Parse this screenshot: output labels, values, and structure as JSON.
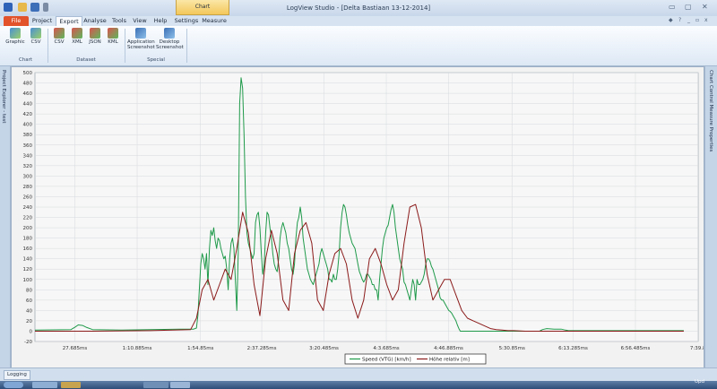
{
  "window": {
    "title": "LogView Studio - [Delta Bastiaan 13-12-2014]",
    "context_tab": "Chart",
    "controls": [
      "▭",
      "▢",
      "✕"
    ],
    "mini_controls": [
      "◆",
      "?",
      "_",
      "▫",
      "x"
    ]
  },
  "ribbon": {
    "tabs": [
      "File",
      "Project",
      "Export",
      "Analyse",
      "Tools",
      "View",
      "Help",
      "Settings",
      "Measure"
    ],
    "active_tab": "Export",
    "groups": [
      {
        "label": "Chart",
        "buttons": [
          {
            "l1": "Graphic",
            "l2": ""
          },
          {
            "l1": "CSV",
            "l2": ""
          }
        ]
      },
      {
        "label": "Dataset",
        "buttons": [
          {
            "l1": "CSV",
            "l2": ""
          },
          {
            "l1": "XML",
            "l2": ""
          },
          {
            "l1": "JSON",
            "l2": ""
          },
          {
            "l1": "KML",
            "l2": ""
          }
        ]
      },
      {
        "label": "Special",
        "buttons": [
          {
            "l1": "Application",
            "l2": "Screenshot"
          },
          {
            "l1": "Desktop",
            "l2": "Screenshot"
          }
        ]
      }
    ]
  },
  "sidepanels": {
    "left": "Project Explorer - test",
    "right": "Chart Control  Measure  Properties"
  },
  "bottom": {
    "logging_tab": "Logging",
    "status": "Upd"
  },
  "chart_data": {
    "type": "line",
    "yticks": [
      -20,
      0,
      20,
      40,
      60,
      80,
      100,
      120,
      140,
      160,
      180,
      200,
      220,
      240,
      260,
      280,
      300,
      320,
      340,
      360,
      380,
      400,
      420,
      440,
      460,
      480,
      500
    ],
    "xticks": [
      "27.685ms",
      "1:10.885ms",
      "1:54.85ms",
      "2:37.285ms",
      "3:20.485ms",
      "4:3.685ms",
      "4:46.885ms",
      "5:30.85ms",
      "6:13.285ms",
      "6:56.485ms",
      "7:39.8"
    ],
    "xtick_seconds": [
      27.685,
      70.885,
      114.85,
      157.285,
      200.485,
      243.685,
      286.885,
      330.85,
      373.285,
      416.485,
      459.8
    ],
    "x_range_seconds": [
      0,
      460
    ],
    "ylim": [
      -20,
      500
    ],
    "grid": true,
    "legend_position": "bottom-center",
    "series": [
      {
        "name": "Speed (VTG) [km/h]",
        "color": "#1f9a4a",
        "x": [
          0,
          25,
          28,
          30,
          33,
          36,
          40,
          60,
          80,
          100,
          110,
          112,
          113,
          114,
          115,
          116,
          117,
          118,
          119,
          120,
          121,
          122,
          123,
          124,
          125,
          126,
          127,
          128,
          129,
          130,
          131,
          132,
          133,
          134,
          135,
          136,
          137,
          138,
          139,
          140,
          141,
          142,
          143,
          144,
          145,
          146,
          147,
          148,
          149,
          150,
          151,
          152,
          153,
          154,
          155,
          156,
          157,
          158,
          159,
          160,
          161,
          162,
          163,
          164,
          165,
          166,
          167,
          168,
          169,
          170,
          171,
          172,
          173,
          174,
          175,
          176,
          177,
          178,
          179,
          180,
          181,
          182,
          183,
          184,
          185,
          186,
          187,
          188,
          189,
          190,
          191,
          192,
          193,
          194,
          195,
          196,
          197,
          198,
          199,
          200,
          201,
          202,
          203,
          204,
          205,
          206,
          207,
          208,
          209,
          210,
          211,
          212,
          213,
          214,
          215,
          216,
          217,
          218,
          219,
          220,
          221,
          222,
          223,
          224,
          225,
          226,
          227,
          228,
          229,
          230,
          231,
          232,
          233,
          234,
          235,
          236,
          237,
          238,
          239,
          240,
          241,
          242,
          243,
          244,
          245,
          246,
          247,
          248,
          249,
          250,
          251,
          252,
          253,
          254,
          255,
          256,
          257,
          258,
          259,
          260,
          261,
          262,
          263,
          264,
          265,
          266,
          267,
          268,
          269,
          270,
          271,
          272,
          273,
          274,
          275,
          276,
          277,
          278,
          279,
          280,
          281,
          282,
          283,
          284,
          285,
          286,
          287,
          288,
          289,
          290,
          291,
          292,
          293,
          294,
          295,
          296,
          297,
          298,
          299,
          300,
          301,
          302,
          303,
          304,
          305,
          306,
          307,
          308,
          309,
          310,
          311,
          312,
          313,
          314,
          315,
          316,
          317,
          318,
          319,
          320,
          321,
          322,
          323,
          324,
          325,
          326,
          327,
          328,
          329,
          330,
          340,
          350,
          352,
          355,
          360,
          365,
          368,
          370,
          380,
          400,
          420,
          440,
          450
        ],
        "y": [
          2,
          3,
          8,
          12,
          11,
          7,
          3,
          2,
          3,
          4,
          4,
          6,
          30,
          80,
          130,
          150,
          140,
          120,
          150,
          90,
          160,
          195,
          185,
          200,
          175,
          160,
          180,
          175,
          160,
          150,
          140,
          145,
          120,
          80,
          140,
          170,
          180,
          160,
          100,
          40,
          150,
          440,
          490,
          470,
          380,
          260,
          190,
          170,
          160,
          150,
          140,
          150,
          210,
          225,
          230,
          200,
          150,
          110,
          130,
          190,
          230,
          225,
          200,
          180,
          150,
          130,
          120,
          115,
          140,
          180,
          200,
          210,
          200,
          190,
          170,
          160,
          140,
          120,
          110,
          130,
          180,
          210,
          220,
          240,
          220,
          180,
          160,
          140,
          120,
          110,
          100,
          95,
          90,
          100,
          110,
          120,
          130,
          150,
          160,
          150,
          140,
          130,
          120,
          100,
          100,
          95,
          110,
          100,
          100,
          120,
          150,
          200,
          230,
          245,
          240,
          225,
          205,
          190,
          180,
          170,
          165,
          160,
          145,
          130,
          115,
          108,
          100,
          95,
          100,
          110,
          110,
          105,
          100,
          90,
          90,
          80,
          80,
          60,
          100,
          130,
          160,
          180,
          190,
          200,
          205,
          220,
          235,
          245,
          230,
          200,
          180,
          160,
          140,
          130,
          120,
          95,
          90,
          80,
          70,
          60,
          80,
          100,
          90,
          60,
          100,
          90,
          90,
          95,
          100,
          110,
          130,
          140,
          140,
          135,
          125,
          120,
          110,
          100,
          90,
          80,
          65,
          60,
          60,
          55,
          50,
          45,
          40,
          38,
          35,
          30,
          25,
          20,
          12,
          5,
          0,
          0,
          0,
          0,
          0,
          0,
          0,
          0,
          0,
          0,
          0,
          0,
          0,
          0,
          0,
          0,
          0,
          0,
          0,
          0,
          0,
          0,
          0,
          0,
          0,
          0,
          0,
          0,
          0,
          0,
          0,
          0,
          0,
          0,
          0,
          0,
          0,
          0,
          3,
          5,
          4,
          4,
          2,
          1,
          1,
          1,
          1,
          1,
          1
        ]
      },
      {
        "name": "Höhe relativ [m]",
        "color": "#8b1a1a",
        "x": [
          0,
          40,
          80,
          108,
          112,
          116,
          120,
          124,
          128,
          132,
          136,
          140,
          144,
          148,
          152,
          156,
          160,
          164,
          168,
          172,
          176,
          180,
          184,
          188,
          192,
          196,
          200,
          204,
          208,
          212,
          216,
          220,
          224,
          228,
          232,
          236,
          240,
          244,
          248,
          252,
          256,
          260,
          264,
          268,
          272,
          276,
          280,
          284,
          288,
          292,
          296,
          300,
          304,
          308,
          312,
          316,
          320,
          324,
          328,
          332,
          340,
          360,
          400,
          440,
          450
        ],
        "y": [
          0,
          0,
          1,
          3,
          25,
          80,
          100,
          60,
          90,
          120,
          100,
          160,
          230,
          190,
          90,
          30,
          140,
          195,
          150,
          60,
          40,
          150,
          195,
          210,
          170,
          60,
          40,
          110,
          150,
          160,
          130,
          60,
          25,
          60,
          140,
          160,
          130,
          90,
          60,
          80,
          170,
          240,
          245,
          200,
          110,
          60,
          80,
          100,
          100,
          70,
          40,
          25,
          20,
          15,
          10,
          5,
          3,
          2,
          1,
          1,
          0,
          0,
          0,
          0,
          0
        ]
      }
    ]
  }
}
